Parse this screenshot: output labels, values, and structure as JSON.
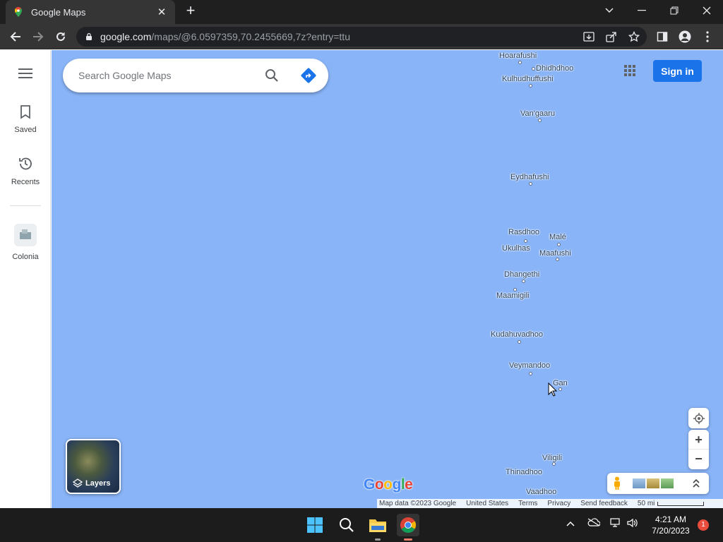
{
  "browser": {
    "tab_title": "Google Maps",
    "url_host": "google.com",
    "url_path": "/maps/@6.0597359,70.2455669,7z?entry=ttu"
  },
  "maps": {
    "search_placeholder": "Search Google Maps",
    "sign_in": "Sign in",
    "layers_label": "Layers",
    "sidebar": {
      "saved": "Saved",
      "recents": "Recents",
      "colonia": "Colonia"
    },
    "places": [
      {
        "name": "Hoarafushi"
      },
      {
        "name": "Dhidhdhoo"
      },
      {
        "name": "Kulhudhuffushi"
      },
      {
        "name": "Van'gaaru"
      },
      {
        "name": "Eydhafushi"
      },
      {
        "name": "Rasdhoo"
      },
      {
        "name": "Malé"
      },
      {
        "name": "Ukulhas"
      },
      {
        "name": "Maafushi"
      },
      {
        "name": "Dhangethi"
      },
      {
        "name": "Maamigili"
      },
      {
        "name": "Kudahuvadhoo"
      },
      {
        "name": "Veymandoo"
      },
      {
        "name": "Gan"
      },
      {
        "name": "Viligili"
      },
      {
        "name": "Thinadhoo"
      },
      {
        "name": "Vaadhoo"
      }
    ],
    "google_logo": "Google",
    "footer": {
      "map_data": "Map data ©2023 Google",
      "region": "United States",
      "terms": "Terms",
      "privacy": "Privacy",
      "feedback": "Send feedback",
      "scale": "50 mi"
    }
  },
  "taskbar": {
    "time": "4:21 AM",
    "date": "7/20/2023",
    "notifications": "1"
  },
  "colors": {
    "water": "#89b4f7",
    "accent": "#1a73e8"
  }
}
